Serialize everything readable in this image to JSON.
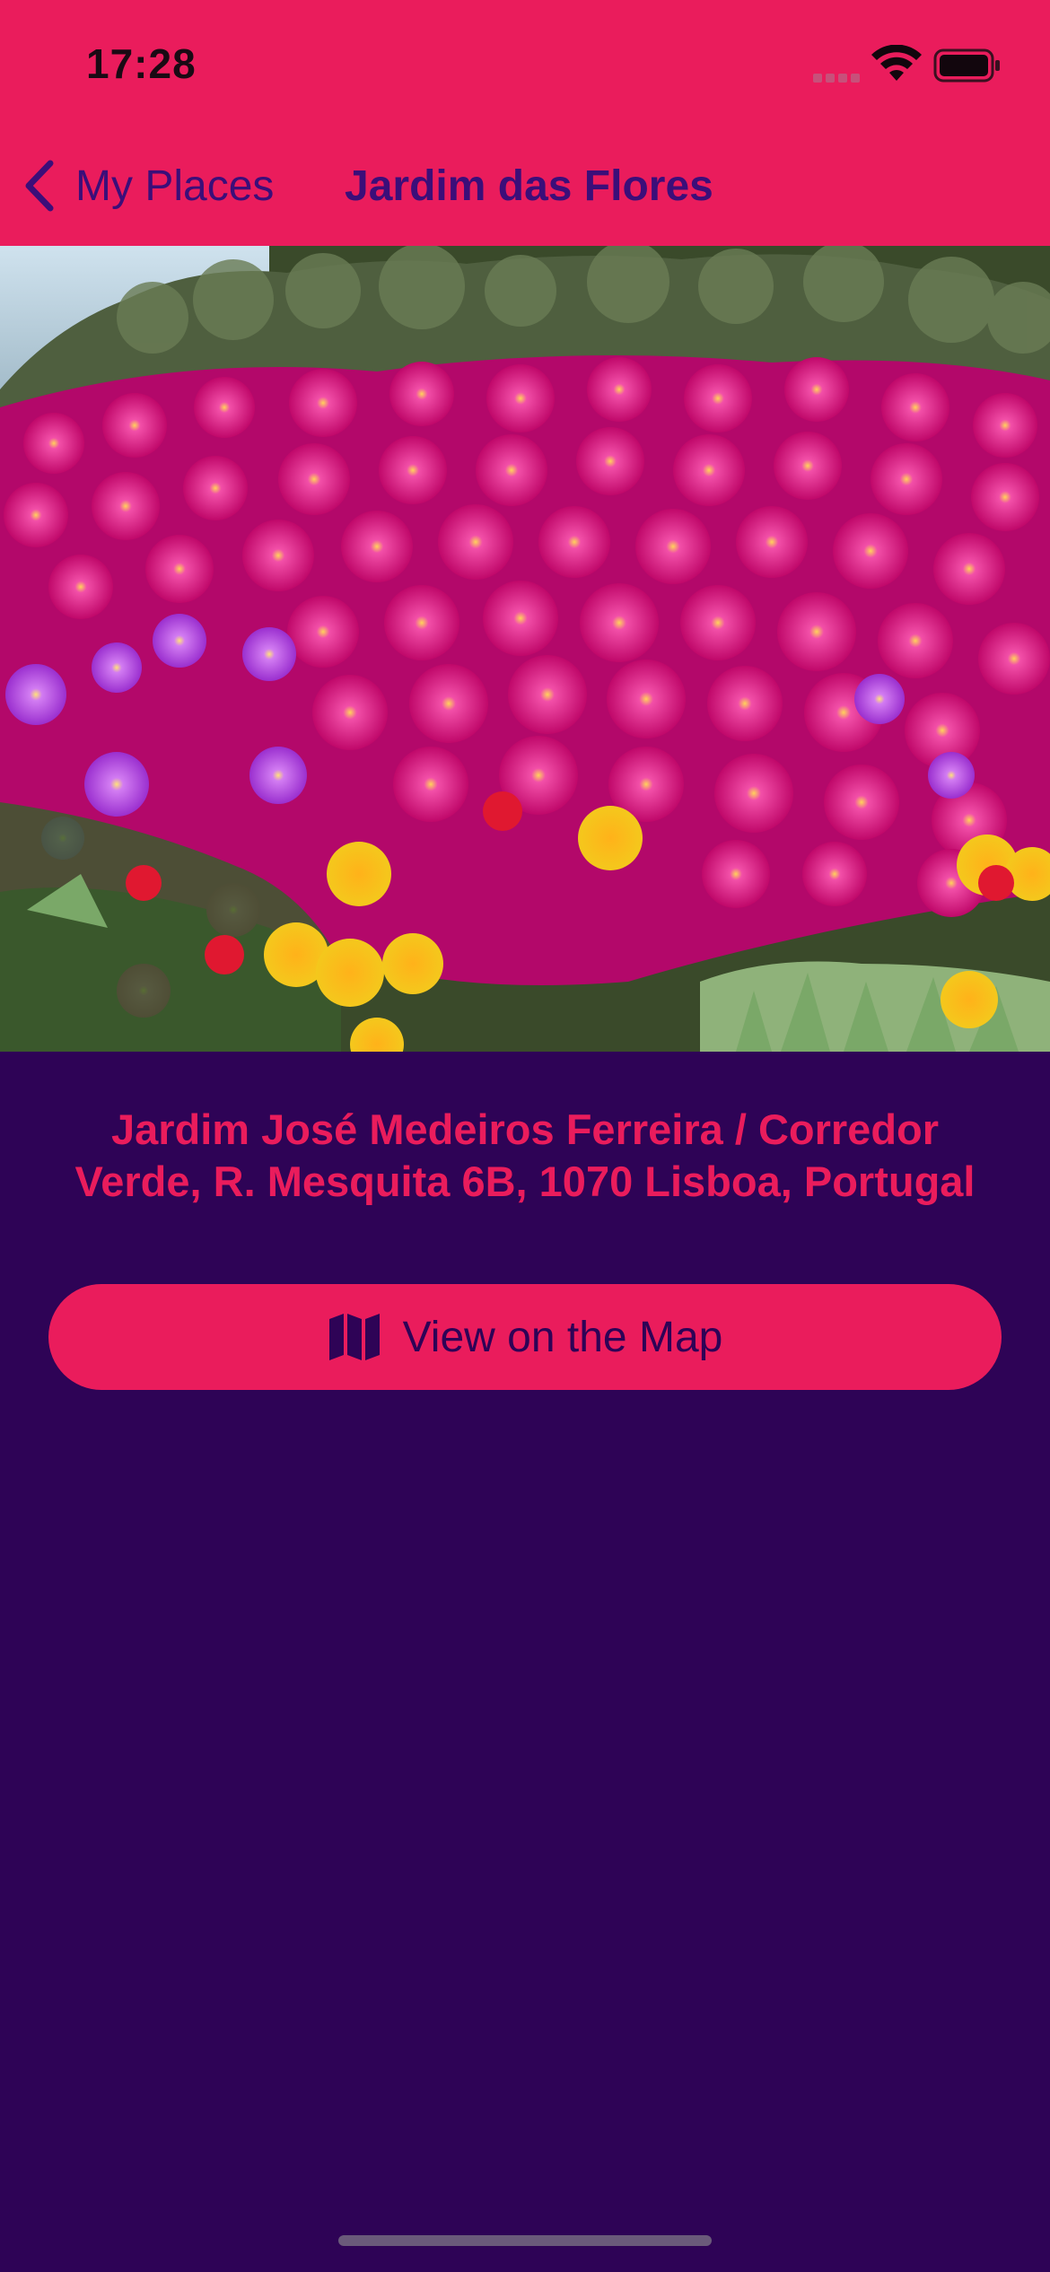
{
  "status_bar": {
    "time": "17:28",
    "icons": [
      "cellular-signal-icon",
      "wifi-icon",
      "battery-icon"
    ]
  },
  "nav": {
    "back_label": "My Places",
    "back_icon": "chevron-left-icon",
    "title": "Jardim das Flores"
  },
  "photo": {
    "subject": "flower-bed-photo"
  },
  "address": {
    "line1": "Jardim José Medeiros Ferreira / Corredor",
    "line2": "Verde, R. Mesquita 6B, 1070 Lisboa, Portugal"
  },
  "actions": {
    "view_map_label": "View on the Map",
    "view_map_icon": "map-icon"
  },
  "colors": {
    "accent": "#ea1c5c",
    "background": "#2e0356",
    "nav_text": "#3b0e79"
  }
}
